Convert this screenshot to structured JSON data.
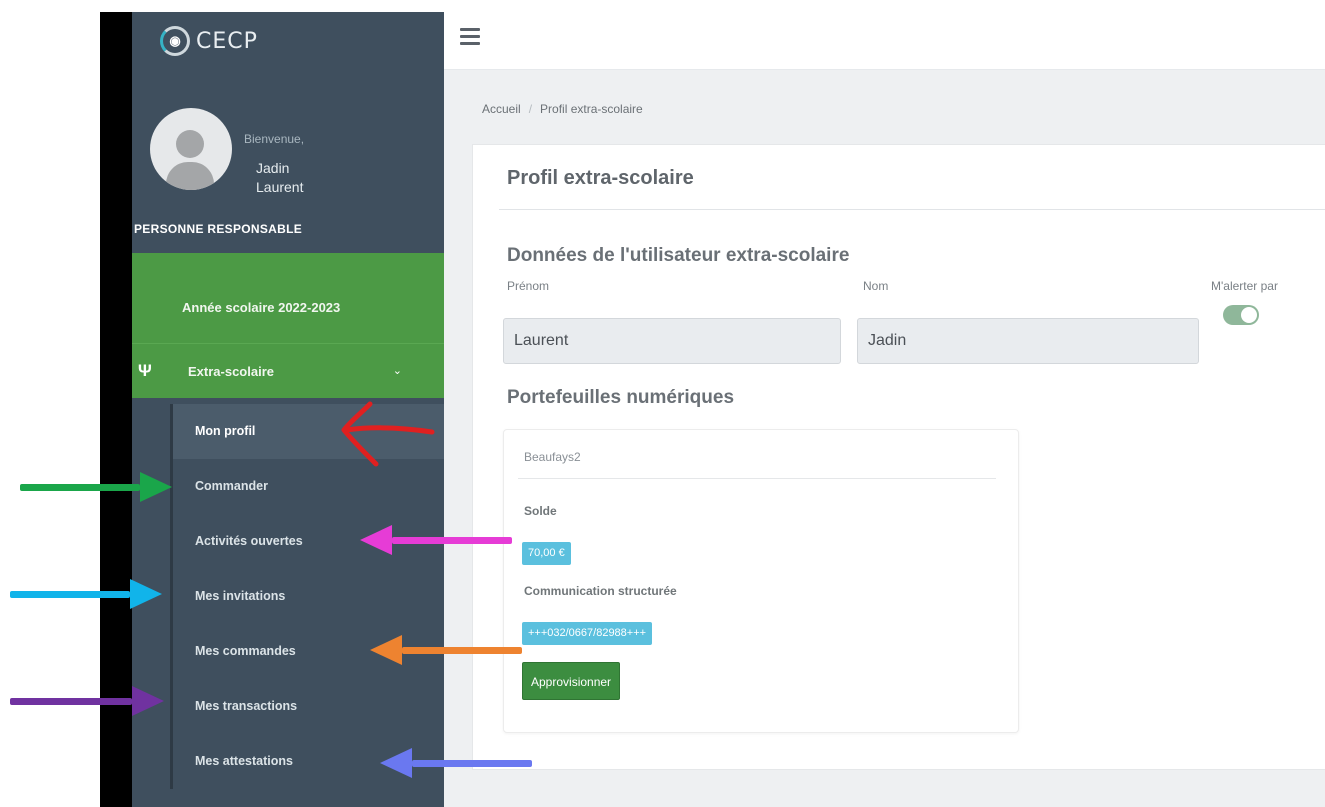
{
  "brand": {
    "name": "CECP",
    "tagline": ""
  },
  "user": {
    "greeting": "Bienvenue,",
    "first_name": "Jadin",
    "last_name": "Laurent",
    "role": "PERSONNE RESPONSABLE"
  },
  "sidebar": {
    "school_year": "Année scolaire 2022-2023",
    "section": "Extra-scolaire",
    "items": [
      {
        "label": "Mon profil",
        "active": true
      },
      {
        "label": "Commander"
      },
      {
        "label": "Activités ouvertes"
      },
      {
        "label": "Mes invitations"
      },
      {
        "label": "Mes commandes"
      },
      {
        "label": "Mes transactions"
      },
      {
        "label": "Mes attestations"
      }
    ]
  },
  "breadcrumb": {
    "home": "Accueil",
    "separator": "/",
    "current": "Profil extra-scolaire"
  },
  "page": {
    "title": "Profil extra-scolaire",
    "user_section": "Données de l'utilisateur extra-scolaire",
    "fields": {
      "first_name_label": "Prénom",
      "first_name_value": "Laurent",
      "last_name_label": "Nom",
      "last_name_value": "Jadin",
      "alert_label": "M'alerter par"
    },
    "wallets_title": "Portefeuilles numériques",
    "wallet": {
      "name": "Beaufays2",
      "balance_label": "Solde",
      "balance_value": "70,00 €",
      "comm_label": "Communication structurée",
      "comm_value": "+++032/0667/82988+++",
      "button": "Approvisionner"
    }
  },
  "colors": {
    "sidebar": "#3f4f5e",
    "green": "#4c9a45",
    "badge": "#5bc0de",
    "button": "#3c8d40",
    "arrow_red": "#e02020",
    "arrow_green": "#1aa64a",
    "arrow_magenta": "#e63cd6",
    "arrow_cyan": "#11b4ea",
    "arrow_orange": "#ee8330",
    "arrow_purple": "#7032a0",
    "arrow_blue": "#6a78f0"
  }
}
